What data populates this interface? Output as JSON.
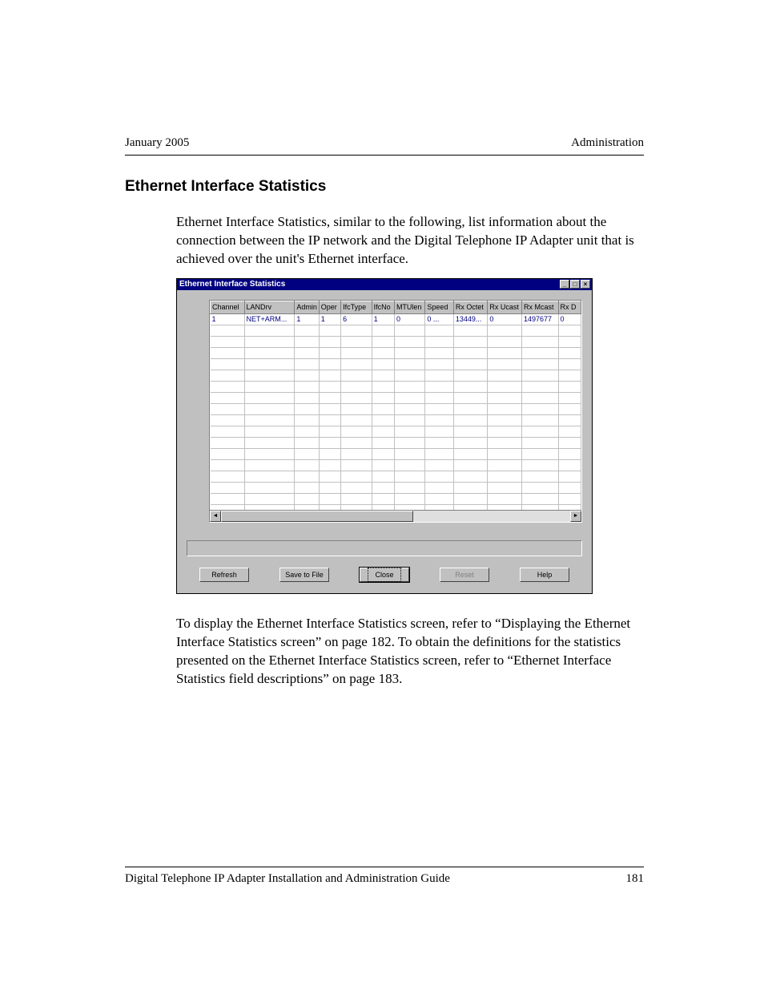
{
  "header": {
    "left": "January 2005",
    "right": "Administration"
  },
  "section_title": "Ethernet Interface Statistics",
  "para1": "Ethernet Interface Statistics, similar to the following, list information about the connection between the IP network and the Digital Telephone IP Adapter unit that is achieved over the unit's Ethernet interface.",
  "para2": "To display the Ethernet Interface Statistics screen, refer to “Displaying the Ethernet Interface Statistics screen” on page 182. To obtain the definitions for the statistics presented on the Ethernet Interface Statistics screen, refer to “Ethernet Interface Statistics field descriptions” on page 183.",
  "window": {
    "title": "Ethernet Interface Statistics",
    "columns": [
      "Channel",
      "LANDrv",
      "Admin",
      "Oper",
      "IfcType",
      "IfcNo",
      "MTUlen",
      "Speed",
      "Rx Octet",
      "Rx Ucast",
      "Rx Mcast",
      "Rx D"
    ],
    "row": [
      "1",
      "NET+ARM...",
      "1",
      "1",
      "6",
      "1",
      "0",
      "0  ...",
      "13449...",
      "0",
      "1497677",
      "0"
    ],
    "buttons": {
      "refresh": "Refresh",
      "save": "Save to File",
      "close": "Close",
      "reset": "Reset",
      "help": "Help"
    },
    "controls": {
      "min": "_",
      "max": "□",
      "close": "×"
    }
  },
  "footer": {
    "left": "Digital Telephone IP Adapter Installation and Administration Guide",
    "right": "181"
  }
}
